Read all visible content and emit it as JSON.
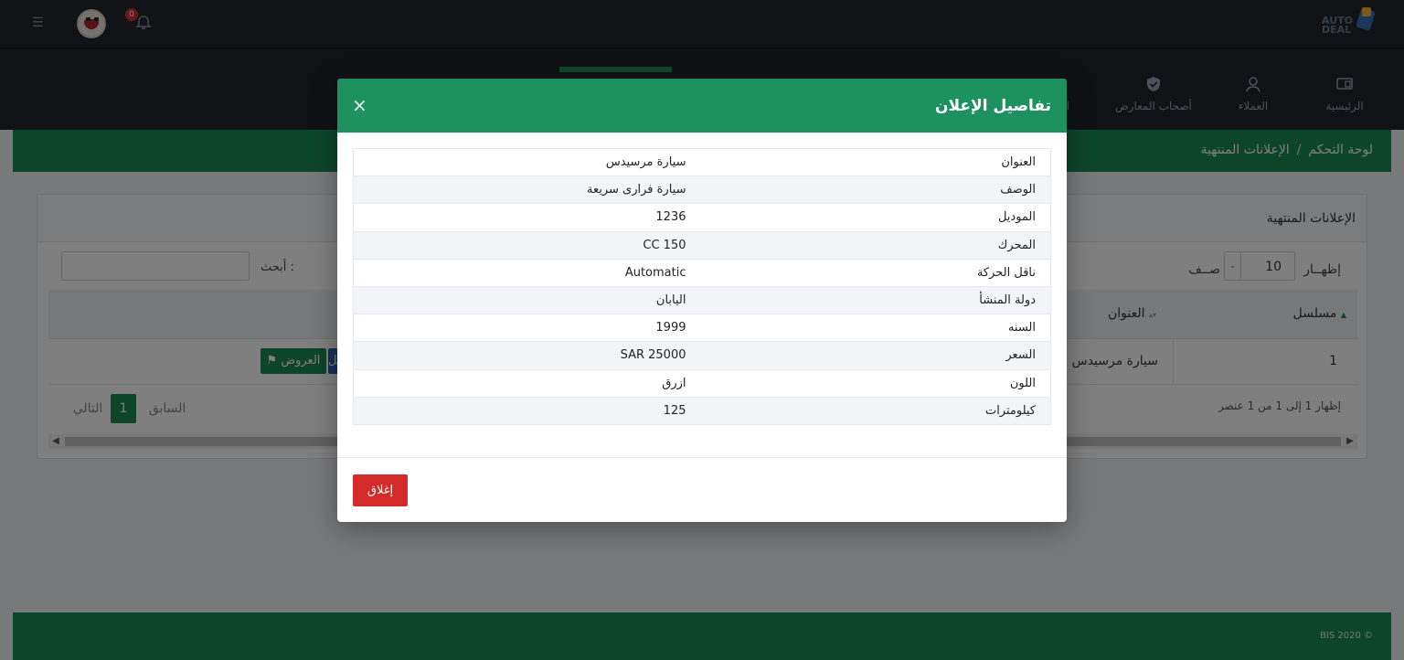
{
  "brand": {
    "logo_text_line1": "AUTO",
    "logo_text_line2": "DEAL"
  },
  "header": {
    "notification_count": "0"
  },
  "nav": {
    "items": [
      {
        "label": "الرئيسية",
        "icon": "dashboard-icon"
      },
      {
        "label": "العملاء",
        "icon": "user-icon"
      },
      {
        "label": "أصحاب المعارض",
        "icon": "shield-check-icon"
      },
      {
        "label": "الإ",
        "icon": ""
      }
    ]
  },
  "breadcrumb": {
    "home": "لوحة التحكم",
    "separator": "/",
    "current": "الإعلانات المنتهية"
  },
  "card": {
    "title": "الإعلانات المنتهية",
    "show_label": "إظهــار",
    "show_value": "10",
    "show_suffix": "صــف",
    "search_label": "أبحث :",
    "columns": [
      "مسلسل",
      "العنوان"
    ],
    "rows": [
      {
        "serial": "1",
        "title": "سيارة مرسيدس"
      }
    ],
    "btn_offers": "العروض",
    "btn_details": "تفاصيل",
    "info": "إظهار 1 إلى 1 من 1 عنصر",
    "pager": {
      "prev": "السابق",
      "current": "1",
      "next": "التالي"
    }
  },
  "footer": {
    "text": "BIS 2020 ©"
  },
  "modal": {
    "title": "تفاصيل الإعلان",
    "rows": [
      {
        "label": "العنوان",
        "value": "سيارة مرسيدس"
      },
      {
        "label": "الوصف",
        "value": "سيارة فرارى سريعة"
      },
      {
        "label": "الموديل",
        "value": "1236"
      },
      {
        "label": "المحرك",
        "value": "CC 150"
      },
      {
        "label": "ناقل الحركة",
        "value": "Automatic"
      },
      {
        "label": "دولة المنشأ",
        "value": "اليابان"
      },
      {
        "label": "السنه",
        "value": "1999"
      },
      {
        "label": "السعر",
        "value": "SAR 25000"
      },
      {
        "label": "اللون",
        "value": "ازرق"
      },
      {
        "label": "كيلومترات",
        "value": "125"
      }
    ],
    "close_label": "إغلاق"
  },
  "colors": {
    "brand_green": "#1a8a57",
    "modal_header": "#1e9161",
    "danger": "#d42a2a",
    "primary_blue": "#2a64b4"
  }
}
